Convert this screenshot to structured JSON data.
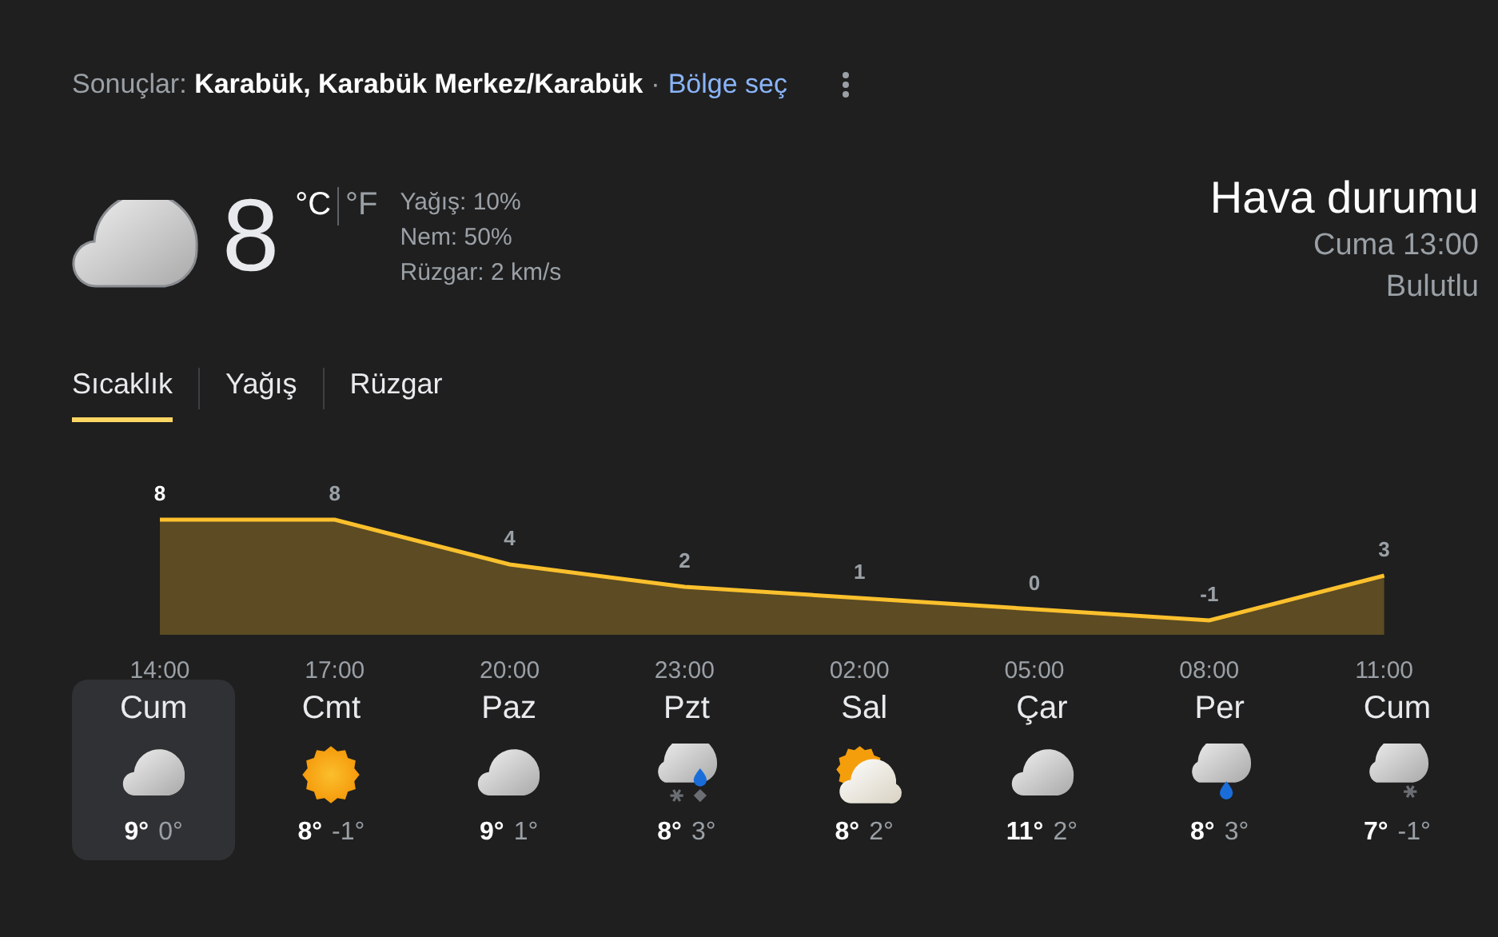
{
  "header": {
    "prefix": "Sonuçlar:",
    "location": "Karabük, Karabük Merkez/Karabük",
    "separator": "·",
    "link": "Bölge seç"
  },
  "current": {
    "temperature": "8",
    "units": [
      {
        "label": "°C",
        "selected": true
      },
      {
        "label": "°F",
        "selected": false
      }
    ],
    "details": [
      "Yağış: 10%",
      "Nem: 50%",
      "Rüzgar: 2 km/s"
    ]
  },
  "summary": {
    "title": "Hava durumu",
    "time": "Cuma 13:00",
    "condition": "Bulutlu"
  },
  "tabs": [
    {
      "label": "Sıcaklık",
      "selected": true
    },
    {
      "label": "Yağış",
      "selected": false
    },
    {
      "label": "Rüzgar",
      "selected": false
    }
  ],
  "chart_data": {
    "type": "area",
    "data_labels": true,
    "categories": [
      "14:00",
      "17:00",
      "20:00",
      "23:00",
      "02:00",
      "05:00",
      "08:00",
      "11:00"
    ],
    "series": [
      {
        "color": "#fbc02d",
        "values": [
          8,
          8,
          4,
          2,
          1,
          0,
          -1,
          3
        ]
      }
    ]
  },
  "days": [
    {
      "day": "Cum",
      "kind": "cloudy",
      "high": "9°",
      "low": "0°",
      "selected": true
    },
    {
      "day": "Cmt",
      "kind": "sunny",
      "high": "8°",
      "low": "-1°",
      "selected": false
    },
    {
      "day": "Paz",
      "kind": "cloudy",
      "high": "9°",
      "low": "1°",
      "selected": false
    },
    {
      "day": "Pzt",
      "kind": "mixed",
      "high": "8°",
      "low": "3°",
      "selected": false
    },
    {
      "day": "Sal",
      "kind": "partly",
      "high": "8°",
      "low": "2°",
      "selected": false
    },
    {
      "day": "Çar",
      "kind": "cloudy",
      "high": "11°",
      "low": "2°",
      "selected": false
    },
    {
      "day": "Per",
      "kind": "rain",
      "high": "8°",
      "low": "3°",
      "selected": false
    },
    {
      "day": "Cum",
      "kind": "snow",
      "high": "7°",
      "low": "-1°",
      "selected": false
    }
  ]
}
